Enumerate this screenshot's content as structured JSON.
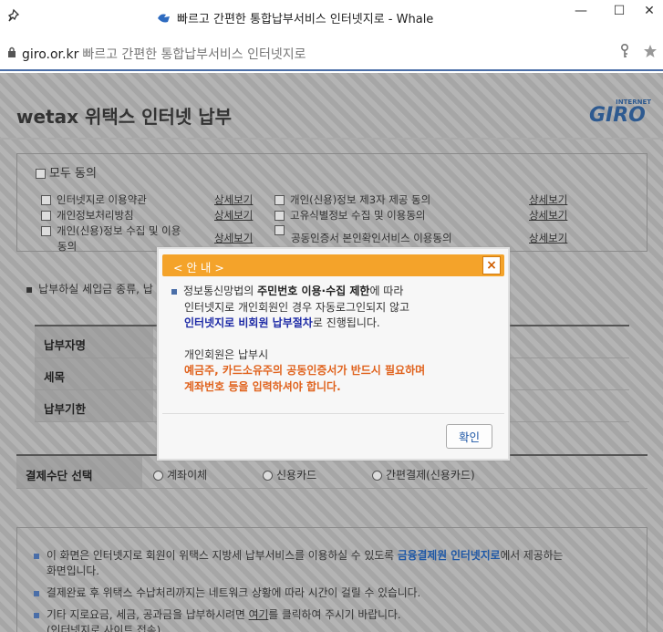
{
  "browser": {
    "title": "빠르고 간편한 통합납부서비스 인터넷지로 - Whale",
    "url": "giro.or.kr",
    "url_desc": "빠르고 간편한 통합납부서비스 인터넷지로",
    "minimize": "—",
    "maximize": "☐",
    "close": "✕"
  },
  "page": {
    "title": "wetax 위택스 인터넷 납부",
    "logo_internet": "INTERNET",
    "logo_word": "GIRO"
  },
  "agreements": {
    "all_label": "모두 동의",
    "detail_label": "상세보기",
    "left": [
      "인터넷지로 이용약관",
      "개인정보처리방침",
      "개인(신용)정보 수집 및 이용",
      "동의"
    ],
    "right": [
      "개인(신용)정보 제3자 제공 동의",
      "고유식별정보 수집 및 이용동의",
      "공동인증서 본인확인서비스 이용동의"
    ]
  },
  "notice_line": "납부하실 세입금 종류, 납",
  "info_table": {
    "rows": [
      "납부자명",
      "세목",
      "납부기한"
    ]
  },
  "payment": {
    "header": "결제수단 선택",
    "options": [
      "계좌이체",
      "신용카드",
      "간편결제(신용카드)"
    ]
  },
  "bottom_info": {
    "line1_a": "이 화면은 인터넷지로 회원이 위택스 지방세 납부서비스를 이용하실 수 있도록 ",
    "line1_hl": "금융결제원 인터넷지로",
    "line1_b": "에서 제공하는",
    "line1_c": "화면입니다.",
    "line2": "결제완료 후 위택스 수납처리까지는 네트워크 상황에 따라 시간이 걸릴 수 있습니다.",
    "line3_a": "기타 지로요금, 세금, 공과금을 납부하시려면 ",
    "line3_link": "여기",
    "line3_b": "를 클릭하여 주시기 바랍니다.",
    "line3_c": "(인터넷지로 사이트 접속)"
  },
  "modal": {
    "title": "< 안 내 >",
    "close": "×",
    "p1_a": "정보통신망법의 ",
    "p1_bold": "주민번호 이용·수집 제한",
    "p1_b": "에 따라",
    "p2": "인터넷지로 개인회원인 경우 자동로그인되지 않고",
    "p3_blue": "인터넷지로 비회원 납부절차",
    "p3_b": "로 진행됩니다.",
    "p4": "개인회원은 납부시",
    "p5_orange": "예금주, 카드소유주의 공동인증서가 반드시 필요하며",
    "p6_orange": "계좌번호 등을 입력하셔야 합니다.",
    "ok": "확인"
  }
}
